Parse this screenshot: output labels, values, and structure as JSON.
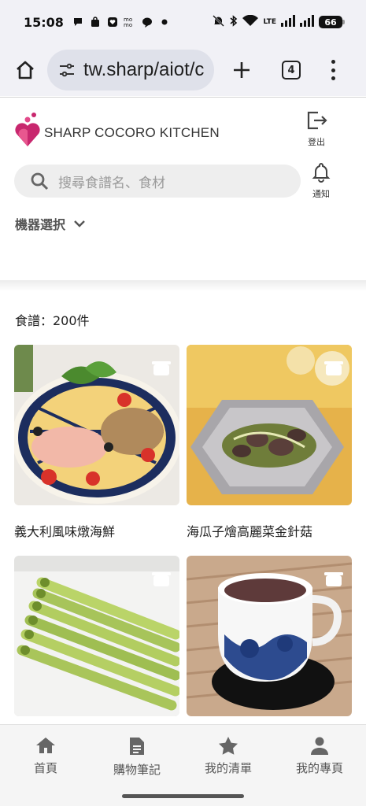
{
  "status_bar": {
    "time": "15:08",
    "battery": "66",
    "network": "LTE"
  },
  "browser": {
    "url": "tw.sharp/aiot/c",
    "tab_count": "4"
  },
  "header": {
    "brand": "SHARP COCORO KITCHEN",
    "logout_label": "登出",
    "notify_label": "通知",
    "search_placeholder": "搜尋食譜名、食材",
    "machine_select": "機器選択"
  },
  "recipes": {
    "count_label": "食譜：200件",
    "items": [
      {
        "title": "義大利風味燉海鮮",
        "icon": "pot-icon"
      },
      {
        "title": "海瓜子燴高麗菜金針菇",
        "icon": "pot-icon"
      },
      {
        "title": "",
        "icon": "pot-icon"
      },
      {
        "title": "",
        "icon": "pot-icon"
      }
    ]
  },
  "bottom_nav": {
    "items": [
      {
        "label": "首頁",
        "icon": "home-icon"
      },
      {
        "label": "購物筆記",
        "icon": "note-icon"
      },
      {
        "label": "我的清單",
        "icon": "star-icon"
      },
      {
        "label": "我的專頁",
        "icon": "person-icon"
      }
    ]
  },
  "colors": {
    "brand_pink": "#c8276e",
    "status_bg": "#f1f1f6",
    "url_pill": "#dfe1ea"
  }
}
